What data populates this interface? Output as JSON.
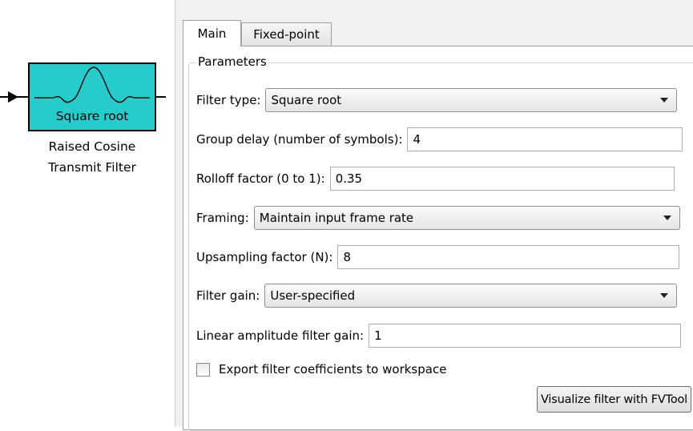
{
  "block": {
    "label": "Square root",
    "caption_line1": "Raised Cosine",
    "caption_line2": "Transmit Filter",
    "color": "#26cccc"
  },
  "tabs": [
    {
      "label": "Main",
      "active": true
    },
    {
      "label": "Fixed-point",
      "active": false
    }
  ],
  "parameters": {
    "title": "Parameters",
    "filter_type": {
      "label": "Filter type:",
      "value": "Square root"
    },
    "group_delay": {
      "label": "Group delay (number of symbols):",
      "value": "4"
    },
    "rolloff": {
      "label": "Rolloff factor (0 to 1):",
      "value": "0.35"
    },
    "framing": {
      "label": "Framing:",
      "value": "Maintain input frame rate"
    },
    "upsampling": {
      "label": "Upsampling factor (N):",
      "value": "8"
    },
    "filter_gain": {
      "label": "Filter gain:",
      "value": "User-specified"
    },
    "linear_gain": {
      "label": "Linear amplitude filter gain:",
      "value": "1"
    },
    "export": {
      "label": "Export filter coefficients to workspace",
      "checked": false
    },
    "visualize_button": "Visualize filter with FVTool"
  },
  "icons": {
    "combo_arrow": "chevron-down-icon",
    "block_glyph": "sinc-pulse-icon",
    "input_arrow": "input-port-arrow-icon"
  }
}
